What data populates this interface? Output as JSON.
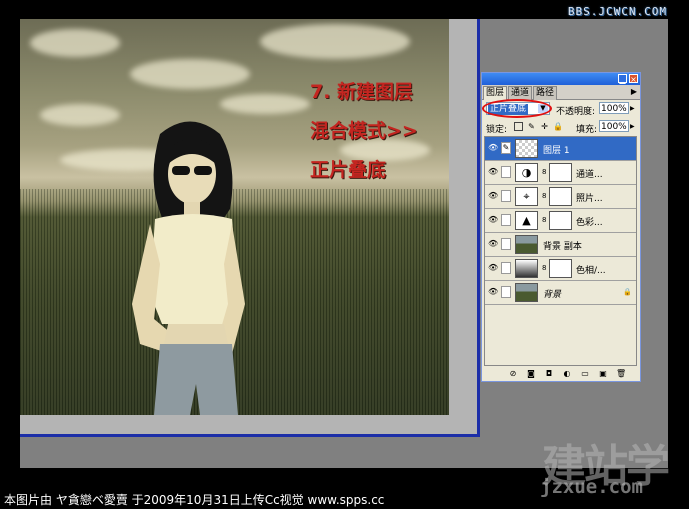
{
  "watermark_top": "BBS.JCWCN.COM",
  "overlay_text": {
    "line1": "7. 新建图层",
    "line2": "混合模式>>",
    "line3": "正片叠底"
  },
  "palette": {
    "tabs": [
      "图层",
      "通道",
      "路径"
    ],
    "menu_icon": "menu-arrow-icon",
    "blend_mode": "正片叠底",
    "opacity_label": "不透明度:",
    "opacity_value": "100%",
    "lock_label": "锁定:",
    "fill_label": "填充:",
    "fill_value": "100%",
    "highlight_color": "#e01010",
    "selected_color": "#316ac5",
    "layers": [
      {
        "name": "图层 1",
        "selected": true
      },
      {
        "name": "通道..."
      },
      {
        "name": "照片..."
      },
      {
        "name": "色彩..."
      },
      {
        "name": "背景 副本"
      },
      {
        "name": "色相/..."
      },
      {
        "name": "背景"
      }
    ]
  },
  "footer_credit": "本图片由 ヤ貪戀ベ愛賣 于2009年10月31日上传Cc视觉 www.spps.cc",
  "logo": {
    "cn": "建站学",
    "url": "jzxue.com"
  }
}
